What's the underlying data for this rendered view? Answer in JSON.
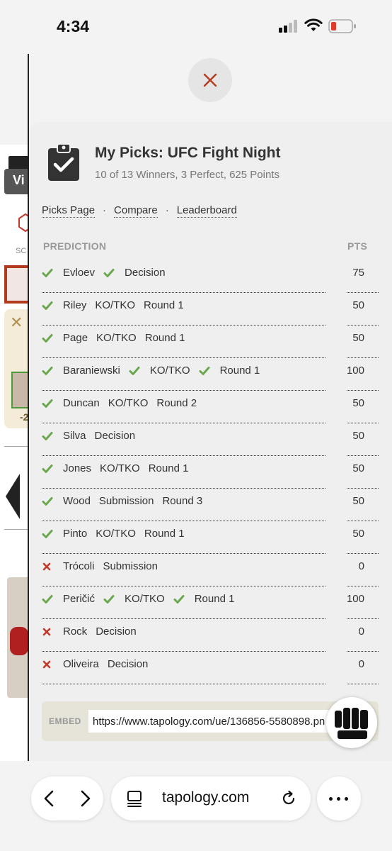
{
  "status_bar": {
    "time": "4:34"
  },
  "background_page": {
    "tab_label": "Vi",
    "sc_label": "SC",
    "neg_label": "-2"
  },
  "panel": {
    "title": "My Picks: UFC Fight Night",
    "subtitle": "10 of 13 Winners, 3 Perfect, 625 Points",
    "links": [
      "Picks Page",
      "Compare",
      "Leaderboard"
    ],
    "link_separator": "·",
    "columns": {
      "prediction": "PREDICTION",
      "points": "PTS"
    },
    "rows": [
      {
        "result": "win",
        "items": [
          {
            "text": "Evloev",
            "check": true
          },
          {
            "text": "Decision",
            "check": true
          }
        ],
        "pts": "75"
      },
      {
        "result": "win",
        "items": [
          {
            "text": "Riley",
            "check": true
          },
          {
            "text": "KO/TKO",
            "check": false
          },
          {
            "text": "Round 1",
            "check": false
          }
        ],
        "pts": "50"
      },
      {
        "result": "win",
        "items": [
          {
            "text": "Page",
            "check": true
          },
          {
            "text": "KO/TKO",
            "check": false
          },
          {
            "text": "Round 1",
            "check": false
          }
        ],
        "pts": "50"
      },
      {
        "result": "win",
        "items": [
          {
            "text": "Baraniewski",
            "check": true
          },
          {
            "text": "KO/TKO",
            "check": true
          },
          {
            "text": "Round 1",
            "check": true
          }
        ],
        "pts": "100"
      },
      {
        "result": "win",
        "items": [
          {
            "text": "Duncan",
            "check": true
          },
          {
            "text": "KO/TKO",
            "check": false
          },
          {
            "text": "Round 2",
            "check": false
          }
        ],
        "pts": "50"
      },
      {
        "result": "win",
        "items": [
          {
            "text": "Silva",
            "check": true
          },
          {
            "text": "Decision",
            "check": false
          }
        ],
        "pts": "50"
      },
      {
        "result": "win",
        "items": [
          {
            "text": "Jones",
            "check": true
          },
          {
            "text": "KO/TKO",
            "check": false
          },
          {
            "text": "Round 1",
            "check": false
          }
        ],
        "pts": "50"
      },
      {
        "result": "win",
        "items": [
          {
            "text": "Wood",
            "check": true
          },
          {
            "text": "Submission",
            "check": false
          },
          {
            "text": "Round 3",
            "check": false
          }
        ],
        "pts": "50"
      },
      {
        "result": "win",
        "items": [
          {
            "text": "Pinto",
            "check": true
          },
          {
            "text": "KO/TKO",
            "check": false
          },
          {
            "text": "Round 1",
            "check": false
          }
        ],
        "pts": "50"
      },
      {
        "result": "loss",
        "items": [
          {
            "text": "Trócoli",
            "check": false
          },
          {
            "text": "Submission",
            "check": false
          }
        ],
        "pts": "0"
      },
      {
        "result": "win",
        "items": [
          {
            "text": "Peričić",
            "check": true
          },
          {
            "text": "KO/TKO",
            "check": true
          },
          {
            "text": "Round 1",
            "check": true
          }
        ],
        "pts": "100"
      },
      {
        "result": "loss",
        "items": [
          {
            "text": "Rock",
            "check": false
          },
          {
            "text": "Decision",
            "check": false
          }
        ],
        "pts": "0"
      },
      {
        "result": "loss",
        "items": [
          {
            "text": "Oliveira",
            "check": false
          },
          {
            "text": "Decision",
            "check": false
          }
        ],
        "pts": "0"
      }
    ],
    "embed": {
      "label": "EMBED",
      "value": "https://www.tapology.com/ue/136856-5580898.png"
    }
  },
  "browser": {
    "domain": "tapology.com"
  },
  "colors": {
    "check": "#6aa84f",
    "cross": "#c0392b",
    "close_x": "#b23a1f"
  },
  "icons": [
    "close-icon",
    "clipboard-check-icon",
    "check-icon",
    "cross-icon",
    "fist-icon",
    "back-icon",
    "forward-icon",
    "reader-icon",
    "reload-icon",
    "more-icon"
  ]
}
